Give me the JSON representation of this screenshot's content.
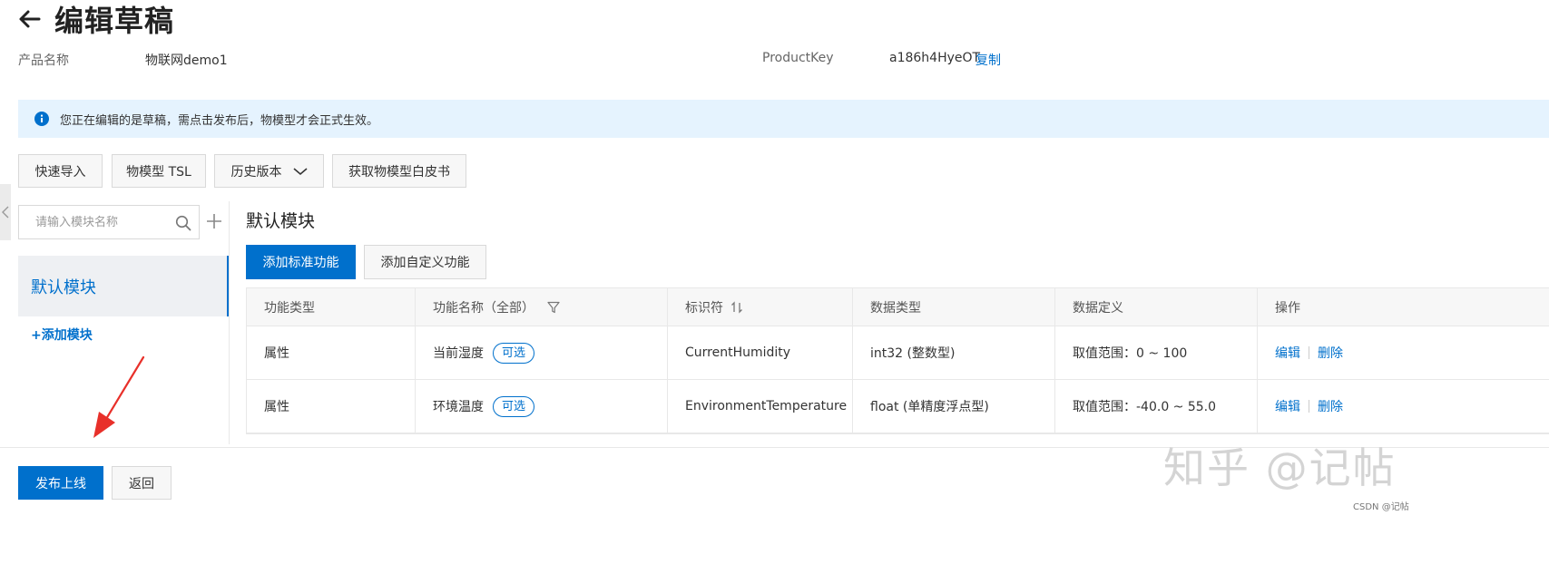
{
  "header": {
    "title": "编辑草稿",
    "product_name_label": "产品名称",
    "product_name_value": "物联网demo1",
    "product_key_label": "ProductKey",
    "product_key_value": "a186h4HyeOT",
    "copy_label": "复制"
  },
  "notice": {
    "text": "您正在编辑的是草稿，需点击发布后，物模型才会正式生效。"
  },
  "toolbar": {
    "quick_import": "快速导入",
    "tsl": "物模型 TSL",
    "history": "历史版本",
    "whitepaper": "获取物模型白皮书"
  },
  "sidebar": {
    "search_placeholder": "请输入模块名称",
    "modules": [
      {
        "label": "默认模块",
        "selected": true
      }
    ],
    "add_module": "+添加模块"
  },
  "main": {
    "section_title": "默认模块",
    "add_standard": "添加标准功能",
    "add_custom": "添加自定义功能",
    "columns": [
      "功能类型",
      "功能名称（全部）",
      "标识符",
      "数据类型",
      "数据定义",
      "操作"
    ],
    "rows": [
      {
        "type": "属性",
        "name": "当前湿度",
        "tag": "可选",
        "identifier": "CurrentHumidity",
        "data_type": "int32 (整数型)",
        "definition": "取值范围：0 ~ 100",
        "edit": "编辑",
        "delete": "删除"
      },
      {
        "type": "属性",
        "name": "环境温度",
        "tag": "可选",
        "identifier": "EnvironmentTemperature",
        "data_type": "float (单精度浮点型)",
        "definition": "取值范围：-40.0 ~ 55.0",
        "edit": "编辑",
        "delete": "删除"
      }
    ]
  },
  "footer": {
    "publish": "发布上线",
    "back": "返回"
  },
  "watermark": {
    "zhihu": "知乎 @记帖",
    "csdn": "CSDN @记帖"
  },
  "colors": {
    "accent": "#0070cc",
    "notice_bg": "#e5f3fe",
    "annotation_arrow": "#e8302a"
  }
}
